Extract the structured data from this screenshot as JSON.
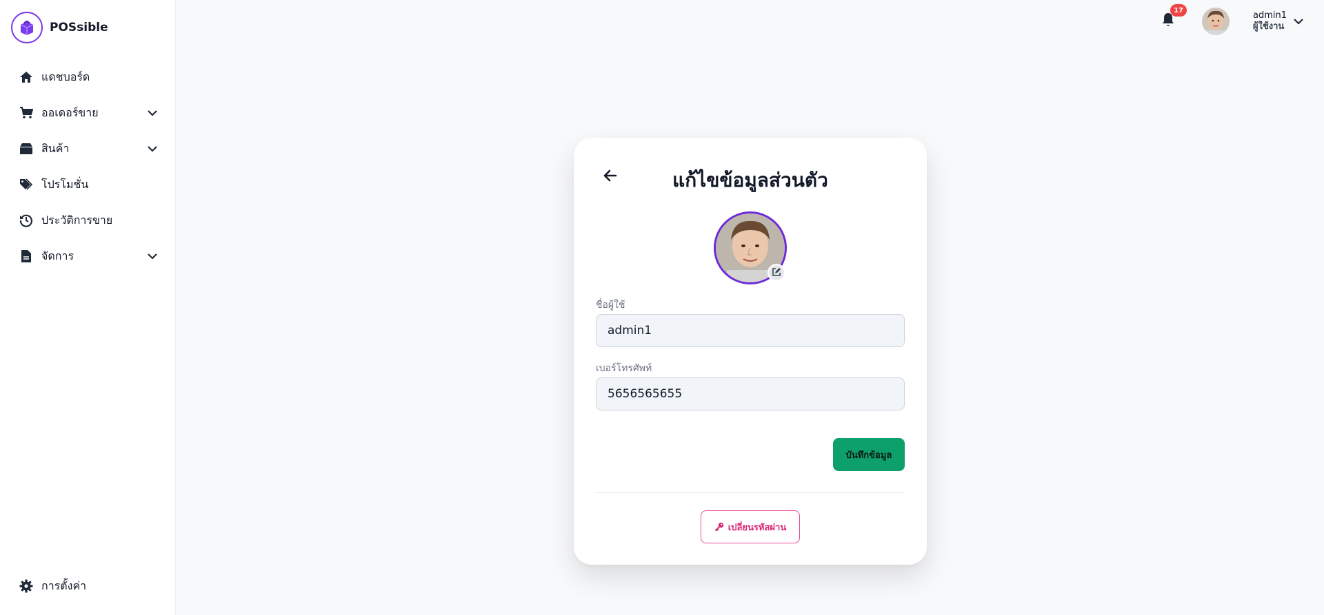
{
  "brand": {
    "name": "POSsible",
    "logo_icon": "shopping-bag-icon",
    "accent": "#7c3aed"
  },
  "sidebar": {
    "items": [
      {
        "label": "แดชบอร์ด",
        "icon": "home-icon",
        "has_submenu": false
      },
      {
        "label": "ออเดอร์ขาย",
        "icon": "cart-icon",
        "has_submenu": true
      },
      {
        "label": "สินค้า",
        "icon": "box-icon",
        "has_submenu": true
      },
      {
        "label": "โปรโมชั่น",
        "icon": "tags-icon",
        "has_submenu": false
      },
      {
        "label": "ประวัติการขาย",
        "icon": "history-icon",
        "has_submenu": false
      },
      {
        "label": "จัดการ",
        "icon": "file-icon",
        "has_submenu": true
      }
    ],
    "settings_label": "การตั้งค่า"
  },
  "topbar": {
    "notification_count": "17",
    "user_name": "admin1",
    "user_role": "ผู้ใช้งาน"
  },
  "profile_form": {
    "title": "แก้ไขข้อมูลส่วนตัว",
    "username_label": "ชื่อผู้ใช้",
    "username_value": "admin1",
    "phone_label": "เบอร์โทรศัพท์",
    "phone_value": "5656565655",
    "save_label": "บันทึกข้อมูล",
    "change_password_label": "เปลี่ยนรหัสผ่าน"
  },
  "colors": {
    "save": "#0ea06a",
    "password": "#ec4899",
    "badge": "#ef4444"
  }
}
